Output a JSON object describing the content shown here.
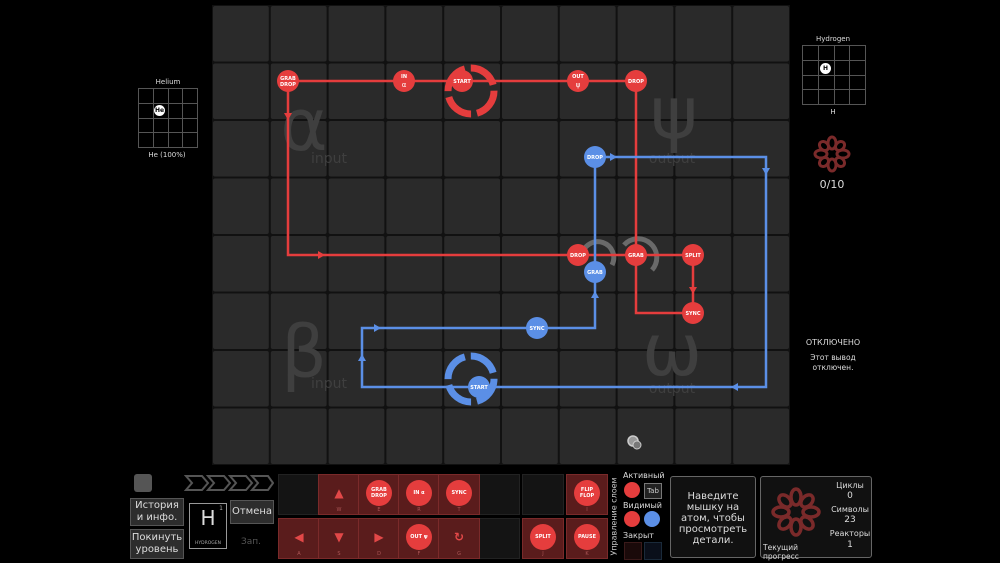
{
  "input_left": {
    "name": "Helium",
    "atom": "He",
    "footer": "He (100%)"
  },
  "output_right": {
    "name": "Hydrogen",
    "atom": "H",
    "footer": "H",
    "progress": "0/10"
  },
  "status": {
    "title": "ОТКЛЮЧЕНО",
    "desc_line1": "Этот вывод",
    "desc_line2": "отключен."
  },
  "board": {
    "zones": {
      "alpha": "α",
      "psi": "ψ",
      "beta": "β",
      "omega": "ω",
      "alpha_label": "input",
      "psi_label": "output",
      "beta_label": "input",
      "omega_label": "output"
    },
    "red_labels": {
      "grab_drop_1": "GRAB",
      "grab_drop_2": "DROP",
      "in": "IN",
      "in_sym": "α",
      "start": "START",
      "out": "OUT",
      "out_sym": "ψ",
      "drop1": "DROP",
      "drop2": "DROP",
      "grab": "GRAB",
      "split": "SPLIT",
      "sync": "SYNC"
    },
    "blue_labels": {
      "drop": "DROP",
      "grab": "GRAB",
      "sync": "SYNC",
      "start": "START"
    }
  },
  "toolbar": {
    "history_line1": "История",
    "history_line2": "и инфо.",
    "leave_line1": "Покинуть",
    "leave_line2": "уровень",
    "cancel": "Отмена",
    "element_symbol": "H",
    "element_number": "1",
    "element_name": "HYDROGEN",
    "zoom_label": "Зап.",
    "layer_control": "Управление слоем",
    "active": "Активный",
    "visible": "Видимый",
    "closed": "Закрыт",
    "tab_key": "Tab",
    "hint_line1": "Наведите",
    "hint_line2": "мышку на",
    "hint_line3": "атом, чтобы",
    "hint_line4": "просмотреть",
    "hint_line5": "детали.",
    "cycles_label": "Циклы",
    "cycles_value": "0",
    "symbols_label": "Символы",
    "symbols_value": "23",
    "reactors_label": "Реакторы",
    "reactors_value": "1",
    "progress_label": "Текущий прогресс"
  },
  "palette": {
    "top": [
      {
        "label": "▲",
        "key": "W"
      },
      {
        "label": "GRAB DROP",
        "key": "E"
      },
      {
        "label": "IN α",
        "key": "R"
      },
      {
        "label": "SYNC",
        "key": "T"
      },
      {
        "label": "FLIP FLOP",
        "key": "I"
      }
    ],
    "bottom": [
      {
        "label": "◀",
        "key": "A"
      },
      {
        "label": "▼",
        "key": "S"
      },
      {
        "label": "▶",
        "key": "D"
      },
      {
        "label": "OUT ψ",
        "key": "F"
      },
      {
        "label": "↻",
        "key": "G"
      },
      {
        "label": "SPLIT",
        "key": "J"
      },
      {
        "label": "PAUSE",
        "key": "K"
      }
    ]
  },
  "colors": {
    "red": "#e53d3d",
    "blue": "#5b8fe6",
    "tile": "#2a2a2a"
  }
}
